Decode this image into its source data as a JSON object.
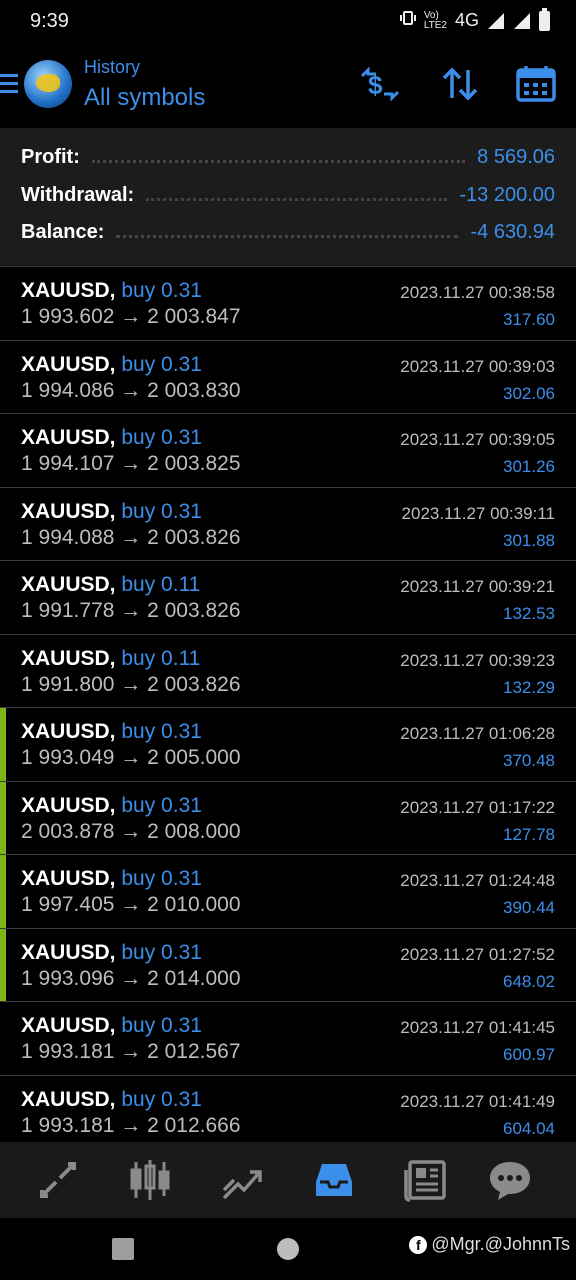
{
  "status": {
    "time": "9:39",
    "network": "4G"
  },
  "header": {
    "subtitle": "History",
    "title": "All symbols"
  },
  "summary": {
    "profit_label": "Profit:",
    "profit_value": "8 569.06",
    "withdrawal_label": "Withdrawal:",
    "withdrawal_value": "-13 200.00",
    "balance_label": "Balance:",
    "balance_value": "-4 630.94"
  },
  "trades": [
    {
      "symbol": "XAUUSD,",
      "direction": "buy 0.31",
      "prices": "1 993.602 → 2 003.847",
      "time": "2023.11.27 00:38:58",
      "profit": "317.60",
      "highlight": false
    },
    {
      "symbol": "XAUUSD,",
      "direction": "buy 0.31",
      "prices": "1 994.086 → 2 003.830",
      "time": "2023.11.27 00:39:03",
      "profit": "302.06",
      "highlight": false
    },
    {
      "symbol": "XAUUSD,",
      "direction": "buy 0.31",
      "prices": "1 994.107 → 2 003.825",
      "time": "2023.11.27 00:39:05",
      "profit": "301.26",
      "highlight": false
    },
    {
      "symbol": "XAUUSD,",
      "direction": "buy 0.31",
      "prices": "1 994.088 → 2 003.826",
      "time": "2023.11.27 00:39:11",
      "profit": "301.88",
      "highlight": false
    },
    {
      "symbol": "XAUUSD,",
      "direction": "buy 0.11",
      "prices": "1 991.778 → 2 003.826",
      "time": "2023.11.27 00:39:21",
      "profit": "132.53",
      "highlight": false
    },
    {
      "symbol": "XAUUSD,",
      "direction": "buy 0.11",
      "prices": "1 991.800 → 2 003.826",
      "time": "2023.11.27 00:39:23",
      "profit": "132.29",
      "highlight": false
    },
    {
      "symbol": "XAUUSD,",
      "direction": "buy 0.31",
      "prices": "1 993.049 → 2 005.000",
      "time": "2023.11.27 01:06:28",
      "profit": "370.48",
      "highlight": true
    },
    {
      "symbol": "XAUUSD,",
      "direction": "buy 0.31",
      "prices": "2 003.878 → 2 008.000",
      "time": "2023.11.27 01:17:22",
      "profit": "127.78",
      "highlight": true
    },
    {
      "symbol": "XAUUSD,",
      "direction": "buy 0.31",
      "prices": "1 997.405 → 2 010.000",
      "time": "2023.11.27 01:24:48",
      "profit": "390.44",
      "highlight": true
    },
    {
      "symbol": "XAUUSD,",
      "direction": "buy 0.31",
      "prices": "1 993.096 → 2 014.000",
      "time": "2023.11.27 01:27:52",
      "profit": "648.02",
      "highlight": true
    },
    {
      "symbol": "XAUUSD,",
      "direction": "buy 0.31",
      "prices": "1 993.181 → 2 012.567",
      "time": "2023.11.27 01:41:45",
      "profit": "600.97",
      "highlight": false
    },
    {
      "symbol": "XAUUSD,",
      "direction": "buy 0.31",
      "prices": "1 993.181 → 2 012.666",
      "time": "2023.11.27 01:41:49",
      "profit": "604.04",
      "highlight": false
    }
  ],
  "nav": [
    "quotes-icon",
    "chart-icon",
    "trade-icon",
    "history-icon",
    "news-icon",
    "chat-icon"
  ],
  "watermark": "@Mgr.@JohnnTs",
  "colors": {
    "accent": "#3b8eea",
    "highlight": "#7cb518",
    "background": "#000000"
  }
}
